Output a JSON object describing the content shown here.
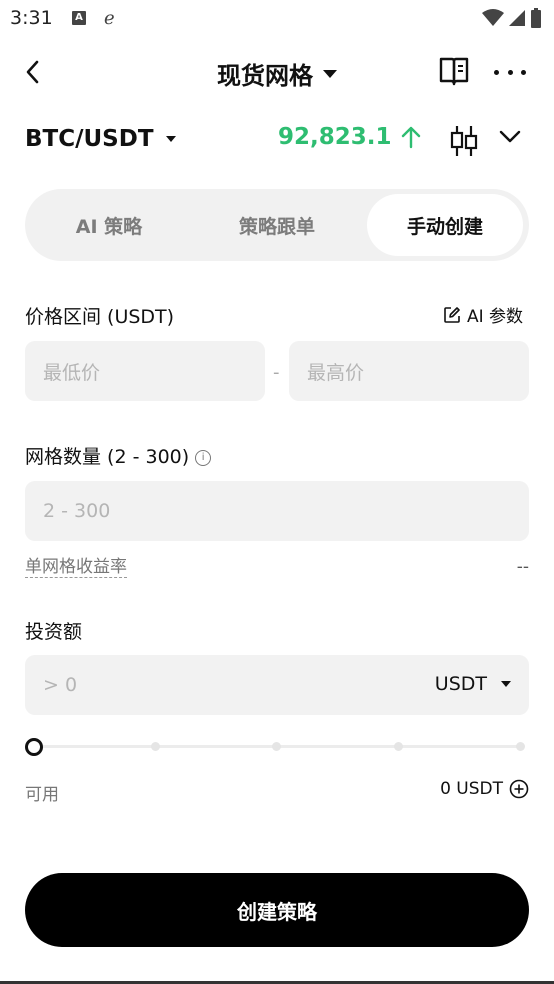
{
  "status_bar": {
    "time": "3:31",
    "icons": [
      "notification-a-icon",
      "browser-e-icon",
      "wifi-icon",
      "signal-icon",
      "battery-icon"
    ]
  },
  "nav": {
    "title": "现货网格",
    "icons": [
      "back-icon",
      "chevron-down-icon",
      "book-icon",
      "more-icon"
    ]
  },
  "pair": {
    "name": "BTC/USDT",
    "price": "92,823.1",
    "price_color": "#2ebd71",
    "price_direction_icon": "arrow-up-icon",
    "icons": [
      "candlestick-icon",
      "chevron-down-icon"
    ]
  },
  "tabs": [
    {
      "label": "AI 策略",
      "active": false
    },
    {
      "label": "策略跟单",
      "active": false
    },
    {
      "label": "手动创建",
      "active": true
    }
  ],
  "price_range": {
    "label": "价格区间 (USDT)",
    "ai_param_label": "AI 参数",
    "min_placeholder": "最低价",
    "separator": "-",
    "max_placeholder": "最高价"
  },
  "grid_count": {
    "label": "网格数量 (2 - 300)",
    "placeholder": "2 - 300",
    "yield_label": "单网格收益率",
    "yield_value": "--"
  },
  "investment": {
    "label": "投资额",
    "placeholder": "> 0",
    "currency": "USDT",
    "slider_percent": 0,
    "available_label": "可用",
    "available_value": "0 USDT"
  },
  "create_button": "创建策略",
  "colors": {
    "accent_green": "#2ebd71",
    "primary_button": "#000000",
    "field_bg": "#f2f2f2"
  }
}
